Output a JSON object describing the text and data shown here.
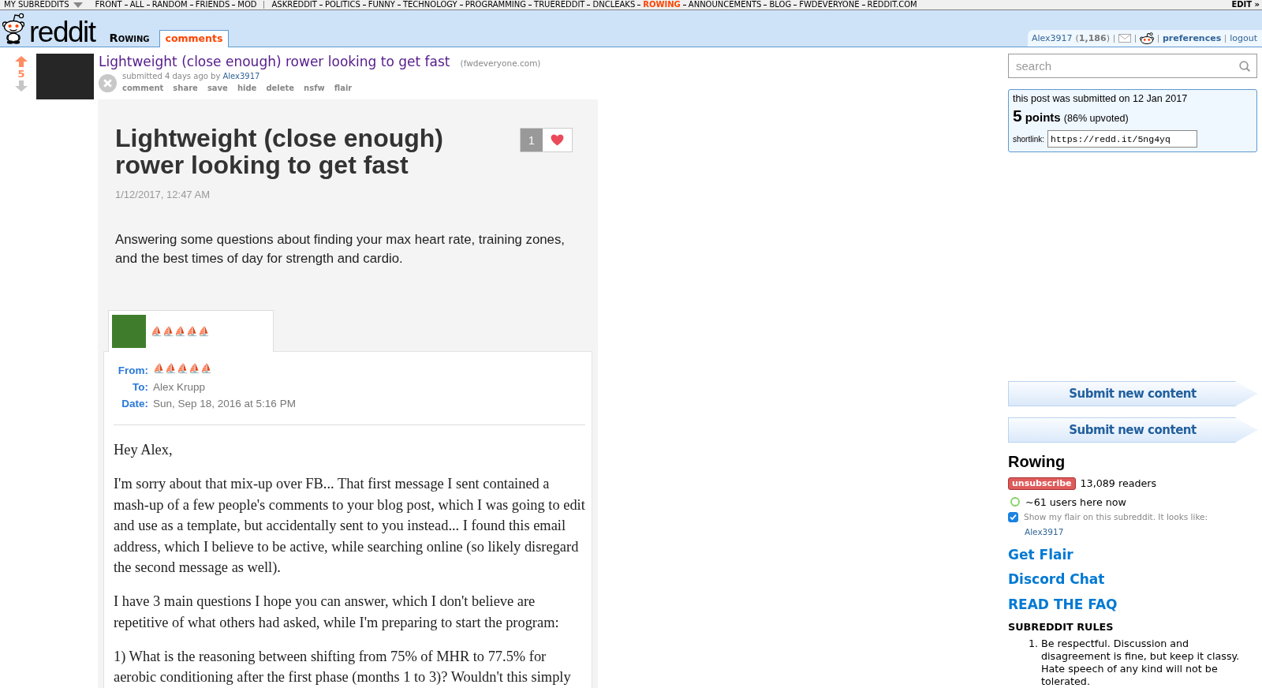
{
  "top_bar": {
    "dropdown": "MY SUBREDDITS",
    "groups": [
      {
        "items": [
          {
            "label": "FRONT",
            "selected": false
          },
          {
            "label": "ALL",
            "selected": false
          },
          {
            "label": "RANDOM",
            "selected": false
          },
          {
            "label": "FRIENDS",
            "selected": false
          },
          {
            "label": "MOD",
            "selected": false
          }
        ]
      },
      {
        "items": [
          {
            "label": "ASKREDDIT",
            "selected": false
          },
          {
            "label": "POLITICS",
            "selected": false
          },
          {
            "label": "FUNNY",
            "selected": false
          },
          {
            "label": "TECHNOLOGY",
            "selected": false
          },
          {
            "label": "PROGRAMMING",
            "selected": false
          },
          {
            "label": "TRUEREDDIT",
            "selected": false
          },
          {
            "label": "DNCLEAKS",
            "selected": false
          },
          {
            "label": "ROWING",
            "selected": true
          },
          {
            "label": "ANNOUNCEMENTS",
            "selected": false
          },
          {
            "label": "BLOG",
            "selected": false
          },
          {
            "label": "FWDEVERYONE",
            "selected": false
          },
          {
            "label": "REDDIT.COM",
            "selected": false
          }
        ]
      }
    ],
    "edit": "EDIT »"
  },
  "header": {
    "logo_text": "reddit",
    "subreddit": "Rowing",
    "tabs": [
      {
        "label": "comments",
        "selected": true
      }
    ],
    "user": {
      "name": "Alex3917",
      "karma": "(**1,186**)",
      "preferences": "preferences",
      "logout": "logout"
    }
  },
  "post": {
    "upvoted": true,
    "downvoted": false,
    "score": "5",
    "title": "Lightweight (close enough) rower looking to get fast",
    "domain": "(fwdeveryone.com)",
    "tagline": "submitted 4 days ago by",
    "author": "Alex3917",
    "buttons": [
      "comment",
      "share",
      "save",
      "hide",
      "delete",
      "nsfw",
      "flair"
    ]
  },
  "expando": {
    "title": "Lightweight (close enough) rower looking to get fast",
    "likes": "1",
    "date": "1/12/2017, 12:47 AM",
    "summary": "Answering some questions about finding your max heart rate, training zones, and the best times of day for strength and cardio.",
    "email": {
      "sender": "⛵⛵⛵⛵⛵",
      "fields": [
        {
          "label": "From:",
          "value": "⛵⛵⛵⛵⛵",
          "kind": "emoji"
        },
        {
          "label": "To:",
          "value": "Alex Krupp",
          "kind": "text"
        },
        {
          "label": "Date:",
          "value": "Sun, Sep 18, 2016 at 5:16 PM",
          "kind": "text"
        }
      ],
      "greeting": "Hey Alex,",
      "paragraphs": [
        "I'm sorry about that mix-up over FB... That first message I sent contained a mash-up of a few people's comments to your blog post, which I was going to edit and use as a template, but accidentally sent to you instead... I found this email address, which I believe to be active, while searching online (so likely disregard the second message as well).",
        "I have 3 main questions I hope you can answer, which I don't believe are repetitive of what others had asked, while I'm preparing to start the program:",
        "1) What is the reasoning between shifting from 75% of MHR to 77.5% for aerobic conditioning after the first phase (months 1 to 3)? Wouldn't this simply"
      ]
    }
  },
  "sidebar": {
    "search": {
      "placeholder": "search"
    },
    "post_info": {
      "submitted": "this post was submitted on 12 Jan 2017",
      "score": "5",
      "score_label": "points",
      "ratio": "(86% upvoted)",
      "shortlink_label": "shortlink:",
      "shortlink": "https://redd.it/5ng4yq"
    },
    "submit_buttons": [
      "Submit new content",
      "Submit new content"
    ],
    "subreddit": {
      "name": "Rowing",
      "subscribed": true,
      "subscribe_label": "unsubscribe",
      "readers": "13,089 readers",
      "online": "~61 users here now",
      "flair_checkbox": {
        "label": "Show my flair on this subreddit. It looks like:",
        "checked": true
      },
      "flair_preview": "Alex3917"
    },
    "links": [
      "Get Flair",
      "Discord Chat",
      "READ THE FAQ"
    ],
    "rules": {
      "title": "SUBREDDIT RULES",
      "items": [
        {
          "number": "1.",
          "text": "Be respectful. Discussion and disagreement is fine, but keep it classy. Hate speech of any kind will not be tolerated."
        }
      ]
    }
  }
}
